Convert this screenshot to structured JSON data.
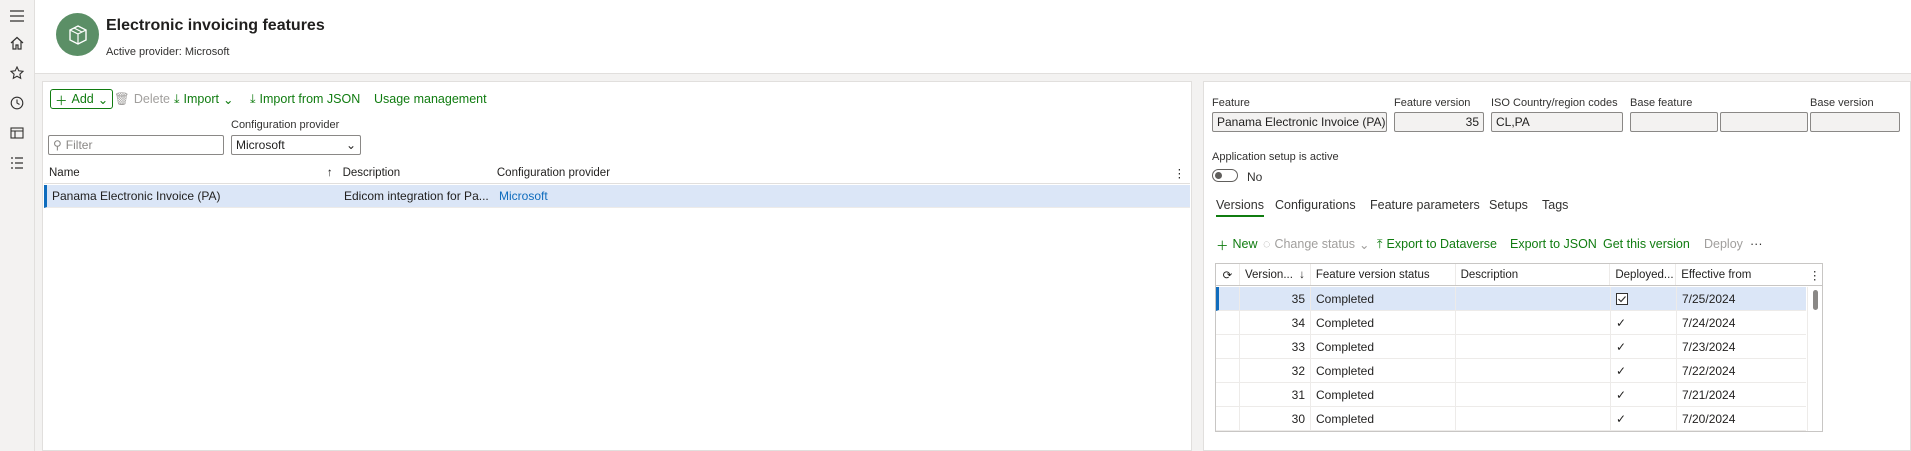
{
  "nav": {
    "icons": [
      "hamburger-icon",
      "home-icon",
      "star-icon",
      "clock-icon",
      "workspace-icon",
      "list-icon"
    ]
  },
  "header": {
    "title": "Electronic invoicing features",
    "subtitle": "Active provider: Microsoft"
  },
  "left": {
    "toolbar": {
      "add": "Add",
      "delete": "Delete",
      "import": "Import",
      "import_json": "Import from JSON",
      "usage": "Usage management"
    },
    "filter_placeholder": "Filter",
    "config_provider_label": "Configuration provider",
    "config_provider_value": "Microsoft",
    "columns": [
      "Name",
      "Description",
      "Configuration provider"
    ],
    "rows": [
      {
        "name": "Panama Electronic Invoice (PA)",
        "description": "Edicom integration for Pa...",
        "provider": "Microsoft"
      }
    ]
  },
  "right": {
    "fields": {
      "feature_label": "Feature",
      "feature_value": "Panama Electronic Invoice (PA)",
      "version_label": "Feature version",
      "version_value": "35",
      "iso_label": "ISO Country/region codes",
      "iso_value": "CL,PA",
      "base_feature_label": "Base feature",
      "base_feature_value": "",
      "base_version_label": "Base version",
      "base_version_value": ""
    },
    "setup_active_label": "Application setup is active",
    "setup_active_state": "No",
    "tabs": [
      "Versions",
      "Configurations",
      "Feature parameters",
      "Setups",
      "Tags"
    ],
    "actions": {
      "new": "New",
      "change_status": "Change status",
      "export_dataverse": "Export to Dataverse",
      "export_json": "Export to JSON",
      "get_version": "Get this version",
      "deploy": "Deploy",
      "more": "···"
    },
    "version_columns": [
      "Version...",
      "Feature version status",
      "Description",
      "Deployed...",
      "Effective from"
    ],
    "versions": [
      {
        "version": "35",
        "status": "Completed",
        "description": "",
        "deployed": "checkbox",
        "effective": "7/25/2024"
      },
      {
        "version": "34",
        "status": "Completed",
        "description": "",
        "deployed": "check",
        "effective": "7/24/2024"
      },
      {
        "version": "33",
        "status": "Completed",
        "description": "",
        "deployed": "check",
        "effective": "7/23/2024"
      },
      {
        "version": "32",
        "status": "Completed",
        "description": "",
        "deployed": "check",
        "effective": "7/22/2024"
      },
      {
        "version": "31",
        "status": "Completed",
        "description": "",
        "deployed": "check",
        "effective": "7/21/2024"
      },
      {
        "version": "30",
        "status": "Completed",
        "description": "",
        "deployed": "check",
        "effective": "7/20/2024"
      }
    ]
  },
  "colors": {
    "accent": "#107c10",
    "link": "#0f6cbd",
    "selected_row": "#dbe6f7",
    "logo": "#5b8f66"
  }
}
